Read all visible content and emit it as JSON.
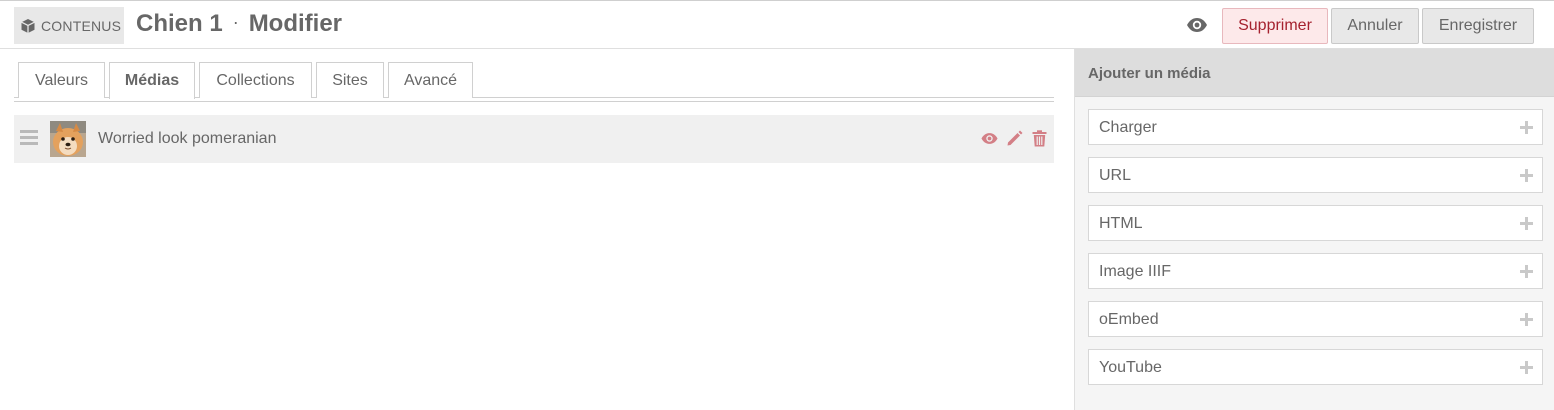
{
  "header": {
    "type_label": "CONTENUS",
    "title_name": "Chien 1",
    "title_separator": "·",
    "title_action": "Modifier",
    "buttons": {
      "view_icon": "eye-icon",
      "delete": "Supprimer",
      "cancel": "Annuler",
      "save": "Enregistrer"
    }
  },
  "tabs": [
    {
      "label": "Valeurs",
      "active": false
    },
    {
      "label": "Médias",
      "active": true
    },
    {
      "label": "Collections",
      "active": false
    },
    {
      "label": "Sites",
      "active": false
    },
    {
      "label": "Avancé",
      "active": false
    }
  ],
  "media": [
    {
      "title": "Worried look pomeranian",
      "actions": [
        "eye-icon",
        "pencil-icon",
        "trash-icon"
      ]
    }
  ],
  "sidebar": {
    "heading": "Ajouter un média",
    "items": [
      {
        "label": "Charger"
      },
      {
        "label": "URL"
      },
      {
        "label": "HTML"
      },
      {
        "label": "Image IIIF"
      },
      {
        "label": "oEmbed"
      },
      {
        "label": "YouTube"
      }
    ]
  },
  "colors": {
    "danger": "#a5222f",
    "danger_bg": "#fde9ea",
    "action_icon": "#d37f86",
    "text": "#676767"
  }
}
